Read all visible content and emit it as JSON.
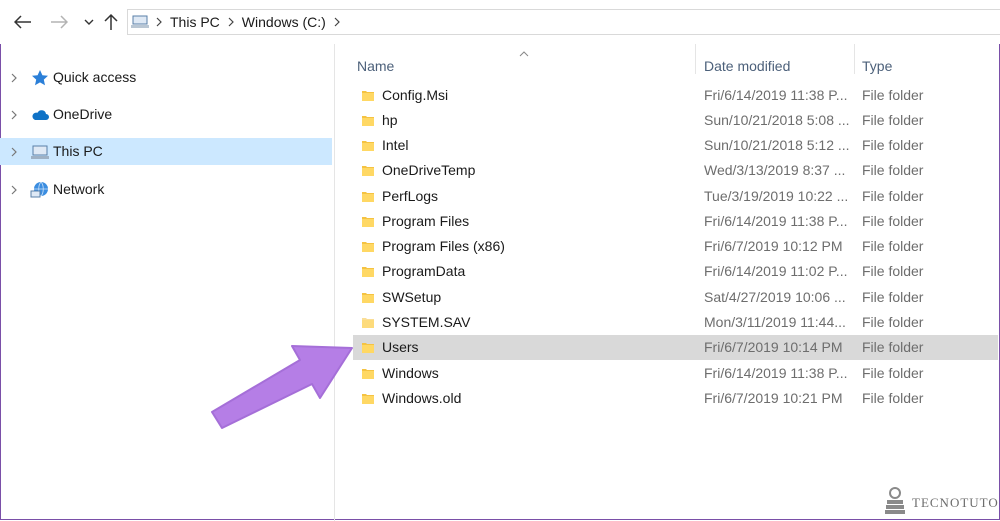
{
  "breadcrumb": [
    "This PC",
    "Windows (C:)"
  ],
  "sidebar": {
    "items": [
      {
        "label": "Quick access",
        "icon": "star-icon",
        "selected": false
      },
      {
        "label": "OneDrive",
        "icon": "cloud-icon",
        "selected": false
      },
      {
        "label": "This PC",
        "icon": "computer-icon",
        "selected": true
      },
      {
        "label": "Network",
        "icon": "network-icon",
        "selected": false
      }
    ]
  },
  "columns": {
    "name": "Name",
    "date": "Date modified",
    "type": "Type"
  },
  "files": [
    {
      "name": "Config.Msi",
      "date": "Fri/6/14/2019 11:38 P...",
      "type": "File folder"
    },
    {
      "name": "hp",
      "date": "Sun/10/21/2018 5:08 ...",
      "type": "File folder"
    },
    {
      "name": "Intel",
      "date": "Sun/10/21/2018 5:12 ...",
      "type": "File folder"
    },
    {
      "name": "OneDriveTemp",
      "date": "Wed/3/13/2019 8:37 ...",
      "type": "File folder"
    },
    {
      "name": "PerfLogs",
      "date": "Tue/3/19/2019 10:22 ...",
      "type": "File folder"
    },
    {
      "name": "Program Files",
      "date": "Fri/6/14/2019 11:38 P...",
      "type": "File folder"
    },
    {
      "name": "Program Files (x86)",
      "date": "Fri/6/7/2019 10:12 PM",
      "type": "File folder"
    },
    {
      "name": "ProgramData",
      "date": "Fri/6/14/2019 11:02 P...",
      "type": "File folder"
    },
    {
      "name": "SWSetup",
      "date": "Sat/4/27/2019 10:06 ...",
      "type": "File folder"
    },
    {
      "name": "SYSTEM.SAV",
      "date": "Mon/3/11/2019 11:44...",
      "type": "File folder"
    },
    {
      "name": "Users",
      "date": "Fri/6/7/2019 10:14 PM",
      "type": "File folder"
    },
    {
      "name": "Windows",
      "date": "Fri/6/14/2019 11:38 P...",
      "type": "File folder"
    },
    {
      "name": "Windows.old",
      "date": "Fri/6/7/2019 10:21 PM",
      "type": "File folder"
    }
  ],
  "highlighted_file": "Users",
  "watermark": "TECNOTUTO",
  "colors": {
    "selection": "#cce8ff",
    "highlight": "#d9d9d9",
    "arrow": "#b57ee6",
    "folder": "#f5c342",
    "frame": "#7a4fa8"
  }
}
